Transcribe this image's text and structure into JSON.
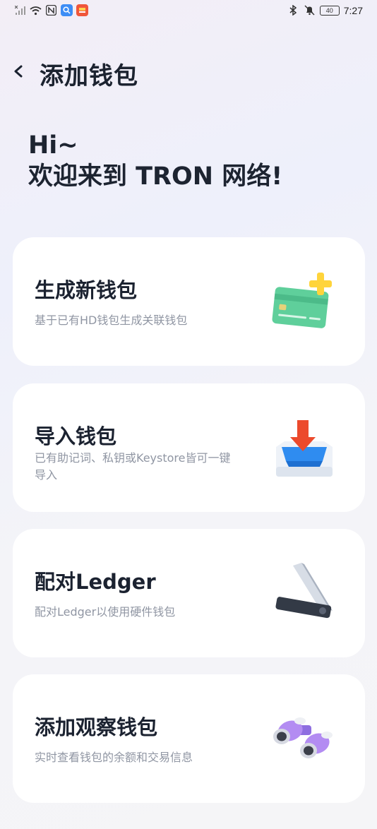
{
  "status_bar": {
    "time": "7:27",
    "battery": "40"
  },
  "header": {
    "title": "添加钱包"
  },
  "greeting": {
    "line1": "Hi~",
    "line2": "欢迎来到 TRON 网络!"
  },
  "options": [
    {
      "title": "生成新钱包",
      "description": "基于已有HD钱包生成关联钱包",
      "icon": "card-plus-icon"
    },
    {
      "title": "导入钱包",
      "description": "已有助记词、私钥或Keystore皆可一键导入",
      "icon": "import-tray-icon"
    },
    {
      "title": "配对Ledger",
      "description": "配对Ledger以使用硬件钱包",
      "icon": "ledger-device-icon"
    },
    {
      "title": "添加观察钱包",
      "description": "实时查看钱包的余额和交易信息",
      "icon": "binoculars-icon"
    }
  ]
}
